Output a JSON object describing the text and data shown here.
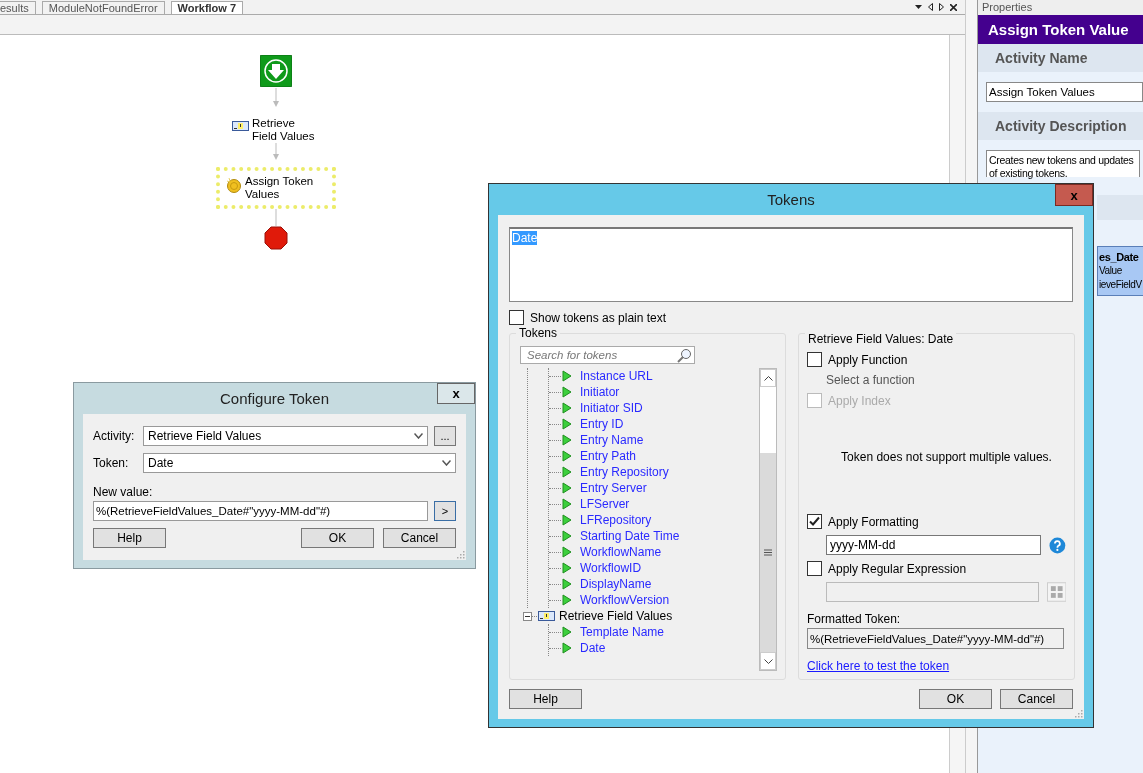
{
  "tabs": [
    {
      "label": "esults",
      "selected": false
    },
    {
      "label": "ModuleNotFoundError",
      "selected": false
    },
    {
      "label": "Workflow 7",
      "selected": true
    }
  ],
  "workflow": {
    "nodes": [
      {
        "kind": "start"
      },
      {
        "kind": "retrieve",
        "label": "Retrieve Field Values",
        "selected": false
      },
      {
        "kind": "assign",
        "label": "Assign Token Values",
        "selected": true
      },
      {
        "kind": "end"
      }
    ]
  },
  "properties": {
    "title": "Properties",
    "heading": "Assign Token Value",
    "sections": [
      {
        "title": "Activity Name",
        "value": "Assign Token Values"
      },
      {
        "title": "Activity Description",
        "value": "Creates new tokens and updates of existing tokens."
      }
    ],
    "card": {
      "title": "es_Date",
      "lines": [
        "Value",
        "ieveFieldV"
      ]
    }
  },
  "configure_token": {
    "title": "Configure Token",
    "close": "x",
    "activity": {
      "label": "Activity:",
      "value": "Retrieve Field Values",
      "browse": "..."
    },
    "token": {
      "label": "Token:",
      "value": "Date"
    },
    "new_value": {
      "label": "New value:",
      "value": "%(RetrieveFieldValues_Date#\"yyyy-MM-dd\"#)",
      "insert": ">"
    },
    "buttons": [
      "Help",
      "OK",
      "Cancel"
    ]
  },
  "tokens_dialog": {
    "title": "Tokens",
    "close": "x",
    "editor_text": "Date",
    "plain_text": {
      "label": "Show tokens as plain text",
      "checked": false
    },
    "tokens_group": {
      "title": "Tokens",
      "search_placeholder": "Search for tokens",
      "tree": [
        {
          "children": [
            {
              "label": "Instance URL"
            },
            {
              "label": "Initiator"
            },
            {
              "label": "Initiator SID"
            },
            {
              "label": "Entry ID"
            },
            {
              "label": "Entry Name"
            },
            {
              "label": "Entry Path"
            },
            {
              "label": "Entry Repository"
            },
            {
              "label": "Entry Server"
            },
            {
              "label": "LFServer"
            },
            {
              "label": "LFRepository"
            },
            {
              "label": "Starting Date Time"
            },
            {
              "label": "WorkflowName"
            },
            {
              "label": "WorkflowID"
            },
            {
              "label": "DisplayName"
            },
            {
              "label": "WorkflowVersion"
            }
          ]
        },
        {
          "label": "Retrieve Field Values",
          "expanded": true,
          "children": [
            {
              "label": "Template Name"
            },
            {
              "label": "Date"
            }
          ]
        }
      ]
    },
    "details": {
      "title": "Retrieve Field Values: Date",
      "apply_function": {
        "label": "Apply Function",
        "checked": false
      },
      "function_hint": "Select a function",
      "apply_index": {
        "label": "Apply Index",
        "checked": false,
        "disabled": true
      },
      "message": "Token does not support multiple values.",
      "apply_formatting": {
        "label": "Apply Formatting",
        "checked": true,
        "value": "yyyy-MM-dd"
      },
      "apply_regex": {
        "label": "Apply Regular Expression",
        "checked": false
      },
      "formatted_label": "Formatted Token:",
      "formatted_value": "%(RetrieveFieldValues_Date#\"yyyy-MM-dd\"#)",
      "test_link": "Click here to test the token"
    },
    "buttons": [
      "Help",
      "OK",
      "Cancel"
    ]
  }
}
